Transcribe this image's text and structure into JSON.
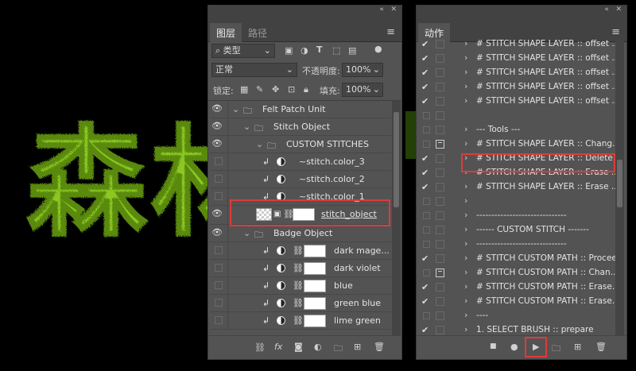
{
  "artwork": {
    "chars": [
      "森",
      "林"
    ],
    "fill": "#8bc820"
  },
  "layers_panel": {
    "tabs": [
      "图层",
      "路径"
    ],
    "filter": {
      "value": "类型"
    },
    "blend_mode": "正常",
    "opacity_label": "不透明度:",
    "opacity_value": "100%",
    "lock_label": "锁定:",
    "fill_label": "填充:",
    "fill_value": "100%",
    "layers": [
      {
        "name": "Felt Patch Unit",
        "kind": "group",
        "visible": true
      },
      {
        "name": "Stitch Object",
        "kind": "group",
        "visible": true
      },
      {
        "name": "CUSTOM STITCHES",
        "kind": "group",
        "visible": true
      },
      {
        "name": "~stitch.color_3",
        "kind": "adjust",
        "visible": false
      },
      {
        "name": "~stitch.color_2",
        "kind": "adjust",
        "visible": false
      },
      {
        "name": "~stitch.color_1",
        "kind": "adjust",
        "visible": false
      },
      {
        "name": "stitch_object",
        "kind": "smart",
        "visible": true
      },
      {
        "name": "Badge Object",
        "kind": "group",
        "visible": true
      },
      {
        "name": "dark mage...",
        "kind": "fill",
        "visible": false
      },
      {
        "name": "dark violet",
        "kind": "fill",
        "visible": false
      },
      {
        "name": "blue",
        "kind": "fill",
        "visible": false
      },
      {
        "name": "green blue",
        "kind": "fill",
        "visible": false
      },
      {
        "name": "lime green",
        "kind": "fill",
        "visible": false
      }
    ]
  },
  "actions_panel": {
    "tab": "动作",
    "actions": [
      {
        "label": "# STITCH SHAPE LAYER :: offset ...",
        "checked": true,
        "dialog": "",
        "chevron": true
      },
      {
        "label": "# STITCH SHAPE LAYER :: offset ...",
        "checked": true,
        "dialog": "",
        "chevron": true
      },
      {
        "label": "# STITCH SHAPE LAYER :: offset ...",
        "checked": true,
        "dialog": "",
        "chevron": true
      },
      {
        "label": "# STITCH SHAPE LAYER :: offset ...",
        "checked": true,
        "dialog": "",
        "chevron": true
      },
      {
        "label": "# STITCH SHAPE LAYER :: offset ...",
        "checked": true,
        "dialog": "",
        "chevron": true
      },
      {
        "label": "",
        "checked": false,
        "dialog": "",
        "chevron": false
      },
      {
        "label": "--- Tools ---",
        "checked": false,
        "dialog": "",
        "chevron": true
      },
      {
        "label": "# STITCH SHAPE LAYER :: Chang...",
        "checked": false,
        "dialog": "icon",
        "chevron": true
      },
      {
        "label": "# STITCH SHAPE LAYER :: Delete...",
        "checked": true,
        "dialog": "",
        "chevron": true
      },
      {
        "label": "# STITCH SHAPE LAYER :: Erase ...",
        "checked": true,
        "dialog": "",
        "chevron": true
      },
      {
        "label": "# STITCH SHAPE LAYER :: Erase ...",
        "checked": true,
        "dialog": "",
        "chevron": true
      },
      {
        "label": "",
        "checked": false,
        "dialog": "",
        "chevron": true
      },
      {
        "label": "------------------------------",
        "checked": false,
        "dialog": "",
        "chevron": true
      },
      {
        "label": "------ CUSTOM STITCH -------",
        "checked": false,
        "dialog": "",
        "chevron": true
      },
      {
        "label": "------------------------------",
        "checked": false,
        "dialog": "",
        "chevron": true
      },
      {
        "label": "# STITCH CUSTOM PATH :: Proceed",
        "checked": true,
        "dialog": "",
        "chevron": true
      },
      {
        "label": "# STITCH CUSTOM PATH :: Chan...",
        "checked": false,
        "dialog": "icon",
        "chevron": true
      },
      {
        "label": "# STITCH CUSTOM PATH :: Erase...",
        "checked": true,
        "dialog": "",
        "chevron": true
      },
      {
        "label": "# STITCH CUSTOM PATH :: Erase...",
        "checked": true,
        "dialog": "",
        "chevron": true
      },
      {
        "label": "----",
        "checked": false,
        "dialog": "",
        "chevron": true
      },
      {
        "label": "1. SELECT BRUSH :: prepare",
        "checked": true,
        "dialog": "",
        "chevron": true
      }
    ]
  }
}
